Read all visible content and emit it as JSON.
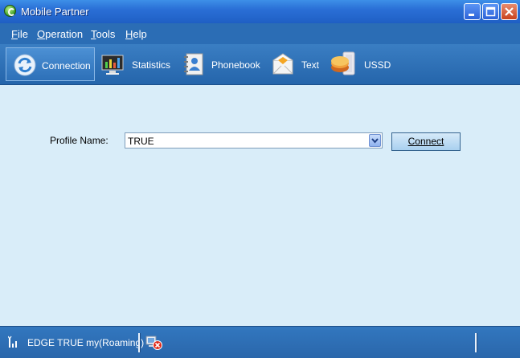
{
  "window": {
    "title": "Mobile Partner"
  },
  "menu": {
    "items": [
      {
        "label": "File"
      },
      {
        "label": "Operation"
      },
      {
        "label": "Tools"
      },
      {
        "label": "Help"
      }
    ]
  },
  "toolbar": {
    "items": [
      {
        "label": "Connection",
        "icon": "connection-icon",
        "active": true
      },
      {
        "label": "Statistics",
        "icon": "statistics-icon"
      },
      {
        "label": "Phonebook",
        "icon": "phonebook-icon"
      },
      {
        "label": "Text",
        "icon": "text-message-icon"
      },
      {
        "label": "USSD",
        "icon": "ussd-icon"
      }
    ]
  },
  "connection": {
    "profile_label": "Profile Name:",
    "profile_value": "TRUE",
    "connect_label": "Connect"
  },
  "status": {
    "text": "EDGE  TRUE my(Roaming)",
    "signal_icon": "signal-strength-icon",
    "disconnected_icon": "network-disconnected-icon"
  },
  "colors": {
    "titlebar": "#2a6fd6",
    "menubar": "#2b6db5",
    "content_bg": "#d9edf9",
    "close_button": "#c9421d"
  }
}
